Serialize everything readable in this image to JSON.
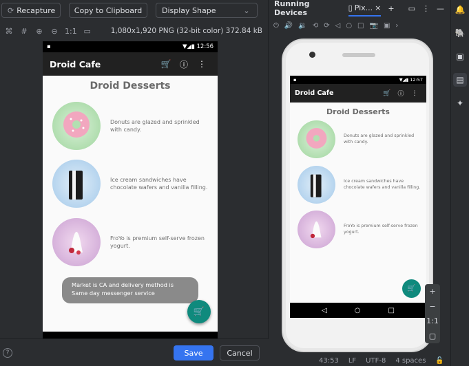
{
  "dialog": {
    "recapture_label": "Recapture",
    "copy_label": "Copy to Clipboard",
    "display_shape": "Display Shape",
    "zoom_ratio": "1:1",
    "image_info": "1,080x1,920 PNG (32-bit color) 372.84 kB",
    "save_label": "Save",
    "cancel_label": "Cancel"
  },
  "capture": {
    "status_time": "12:56",
    "app_title": "Droid Cafe",
    "heading": "Droid Desserts",
    "items": [
      {
        "name": "donut",
        "text": "Donuts are glazed and sprinkled with candy."
      },
      {
        "name": "ice-cream-sandwich",
        "text": "Ice cream sandwiches have chocolate wafers and vanilla filling."
      },
      {
        "name": "froyo",
        "text": "FroYo is premium self-serve frozen yogurt."
      }
    ],
    "toast": "Market is CA and delivery method is Same day messenger service"
  },
  "running_devices": {
    "title": "Running Devices",
    "device_tab": "Pix...",
    "status_time": "12:57",
    "app_title": "Droid Cafe",
    "heading": "Droid Desserts",
    "items": [
      {
        "text": "Donuts are glazed and sprinkled with candy."
      },
      {
        "text": "Ice cream sandwiches have chocolate wafers and vanilla filling."
      },
      {
        "text": "FroYo is premium self-serve frozen yogurt."
      }
    ],
    "zoom_ratio": "1:1"
  },
  "statusbar": {
    "position": "43:53",
    "line_sep": "LF",
    "encoding": "UTF-8",
    "indent": "4 spaces"
  },
  "colors": {
    "accent": "#3574f0",
    "fab": "#0f8a7d",
    "appbar": "#212121"
  }
}
